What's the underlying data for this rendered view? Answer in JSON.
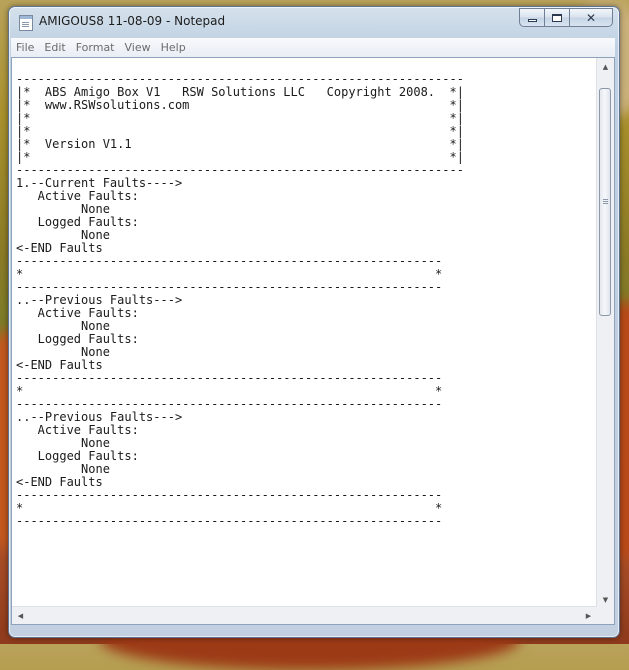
{
  "window": {
    "title": "AMIGOUS8 11-08-09 - Notepad"
  },
  "caption_buttons": {
    "minimize_icon": "minimize-icon",
    "maximize_icon": "maximize-icon",
    "close_icon": "close-icon",
    "close_glyph": "✕"
  },
  "menu": {
    "items": [
      "File",
      "Edit",
      "Format",
      "View",
      "Help"
    ]
  },
  "document": {
    "lines": [
      "--------------------------------------------------------------",
      "|*  ABS Amigo Box V1   RSW Solutions LLC   Copyright 2008.  *|",
      "|*  www.RSWsolutions.com                                    *|",
      "|*                                                          *|",
      "|*                                                          *|",
      "|*  Version V1.1                                            *|",
      "|*                                                          *|",
      "--------------------------------------------------------------",
      "1.--Current Faults---->",
      "   Active Faults:",
      "         None",
      "   Logged Faults:",
      "         None",
      "<-END Faults",
      "-----------------------------------------------------------",
      "*                                                         *",
      "-----------------------------------------------------------",
      "..--Previous Faults--->",
      "   Active Faults:",
      "         None",
      "   Logged Faults:",
      "         None",
      "<-END Faults",
      "-----------------------------------------------------------",
      "*                                                         *",
      "-----------------------------------------------------------",
      "..--Previous Faults--->",
      "   Active Faults:",
      "         None",
      "   Logged Faults:",
      "         None",
      "<-END Faults",
      "-----------------------------------------------------------",
      "*                                                         *",
      "-----------------------------------------------------------"
    ]
  },
  "scrollbars": {
    "up_glyph": "▲",
    "down_glyph": "▼",
    "left_glyph": "◀",
    "right_glyph": "▶"
  }
}
